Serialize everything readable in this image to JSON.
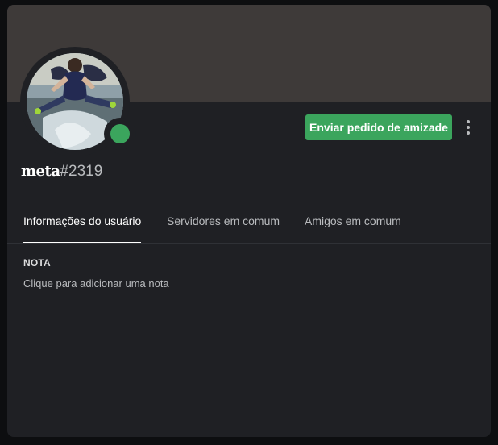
{
  "profile": {
    "username": "meta",
    "discriminator": "#2319",
    "status": "online",
    "status_color": "#3ba55d",
    "banner_color": "#3e3a39"
  },
  "actions": {
    "friend_request_label": "Enviar pedido de amizade",
    "friend_request_color": "#3ba55d",
    "more_icon": "more-vertical-icon"
  },
  "tabs": [
    {
      "label": "Informações do usuário",
      "active": true
    },
    {
      "label": "Servidores em comum",
      "active": false
    },
    {
      "label": "Amigos em comum",
      "active": false
    }
  ],
  "note": {
    "heading": "NOTA",
    "placeholder": "Clique para adicionar uma nota"
  }
}
